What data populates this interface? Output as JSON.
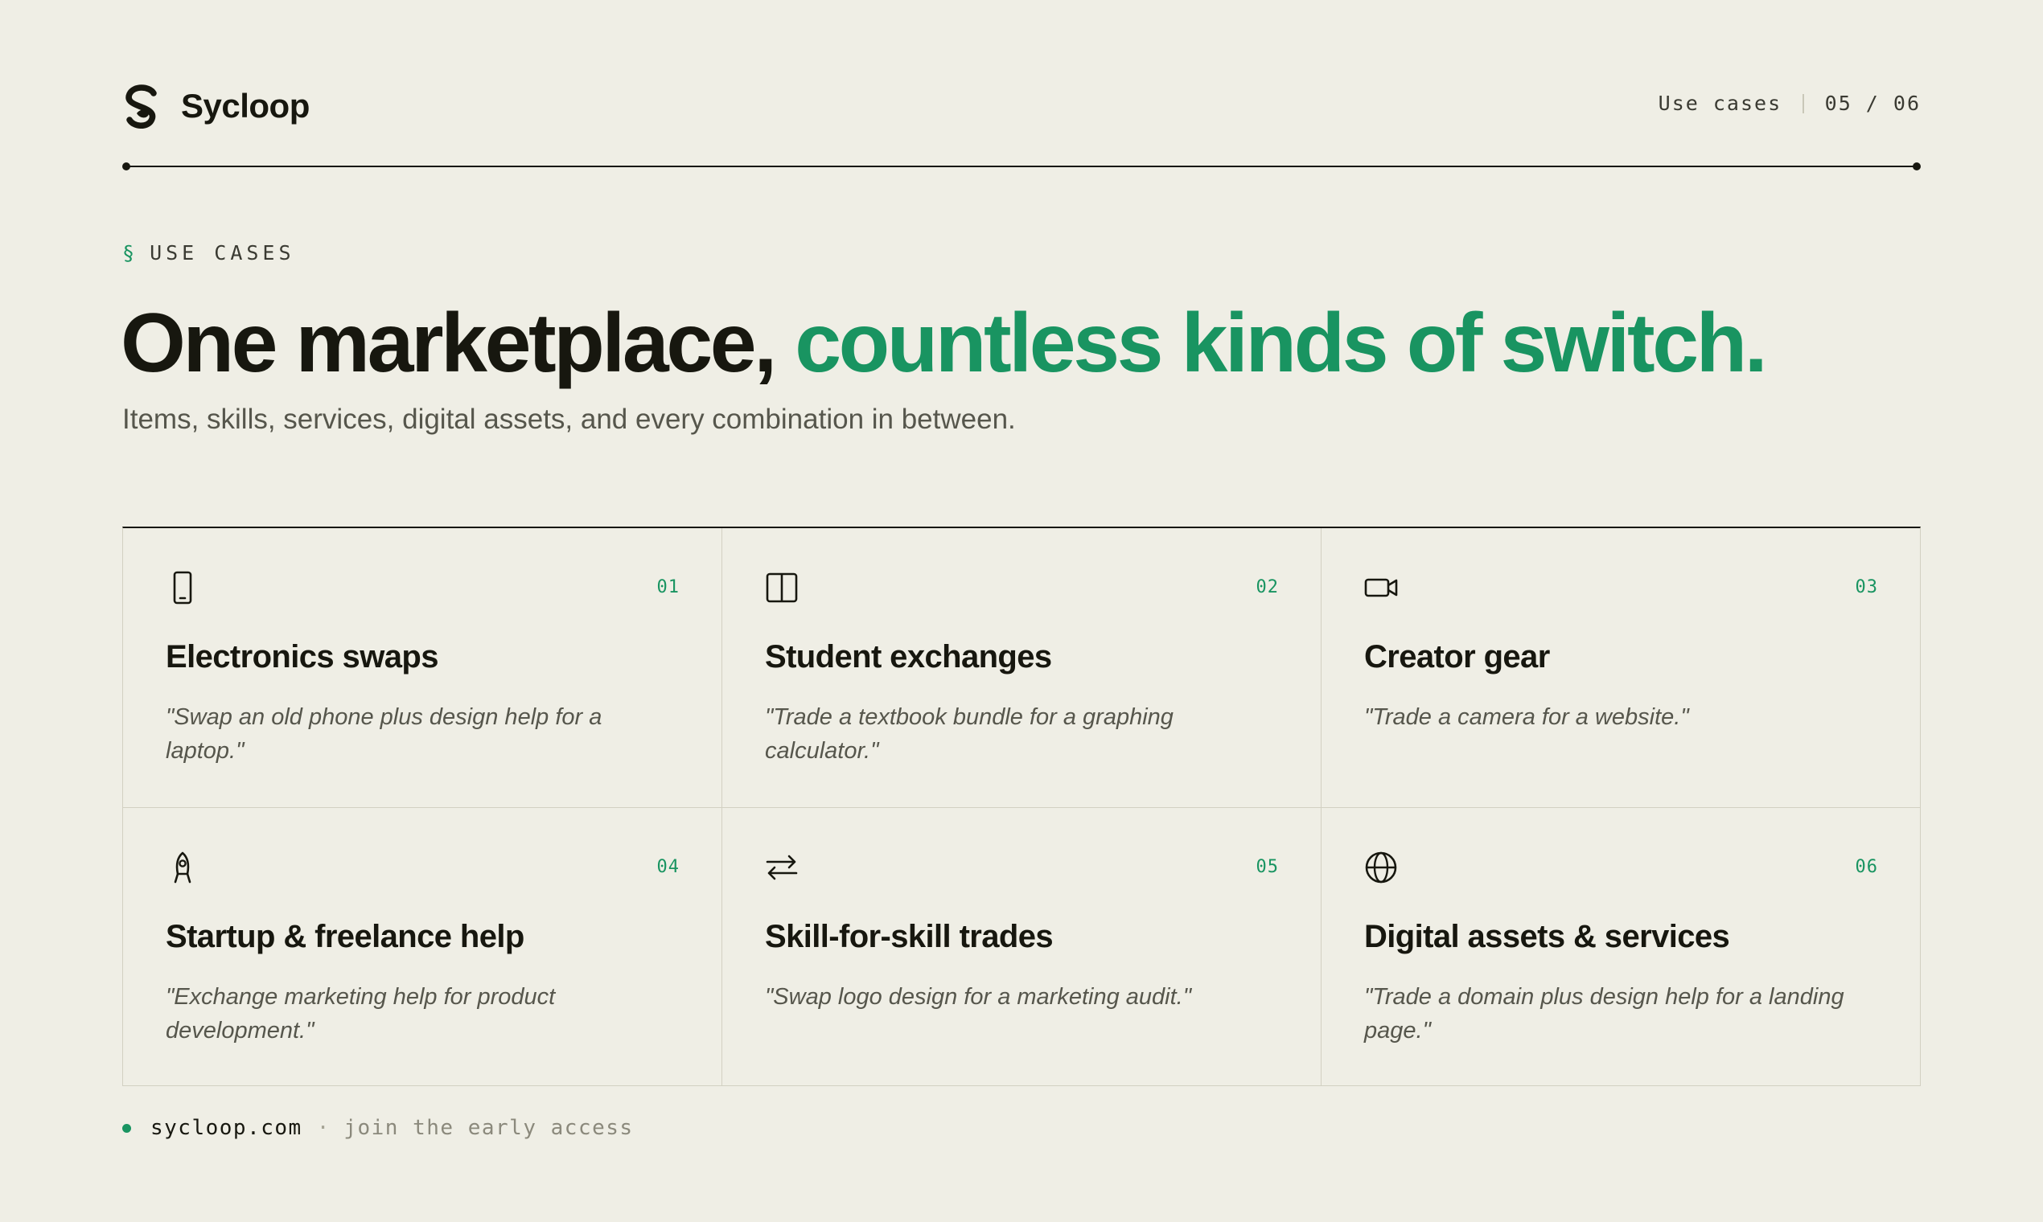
{
  "header": {
    "brand": "Sycloop",
    "section": "Use cases",
    "page": "05 / 06"
  },
  "section_label": {
    "mark": "§",
    "text": "USE CASES"
  },
  "headline": {
    "lead": "One marketplace,",
    "accent": "countless kinds of switch."
  },
  "subhead": "Items, skills, services, digital assets, and every combination in between.",
  "cards": [
    {
      "num": "01",
      "icon": "smartphone-icon",
      "title": "Electronics swaps",
      "quote": "\"Swap an old phone plus design help for a laptop.\""
    },
    {
      "num": "02",
      "icon": "book-open-icon",
      "title": "Student exchanges",
      "quote": "\"Trade a textbook bundle for a graphing calculator.\""
    },
    {
      "num": "03",
      "icon": "video-camera-icon",
      "title": "Creator gear",
      "quote": "\"Trade a camera for a website.\""
    },
    {
      "num": "04",
      "icon": "rocket-icon",
      "title": "Startup & freelance help",
      "quote": "\"Exchange marketing help for product development.\""
    },
    {
      "num": "05",
      "icon": "swap-arrows-icon",
      "title": "Skill-for-skill trades",
      "quote": "\"Swap logo design for a marketing audit.\""
    },
    {
      "num": "06",
      "icon": "globe-icon",
      "title": "Digital assets & services",
      "quote": "\"Trade a domain plus design help for a landing page.\""
    }
  ],
  "footer": {
    "site": "sycloop.com",
    "separator": "·",
    "cta": "join the early access"
  },
  "colors": {
    "background": "#EFEEE5",
    "ink": "#17170F",
    "accent": "#199461",
    "muted": "#56564C",
    "border": "#D2D0C2"
  }
}
